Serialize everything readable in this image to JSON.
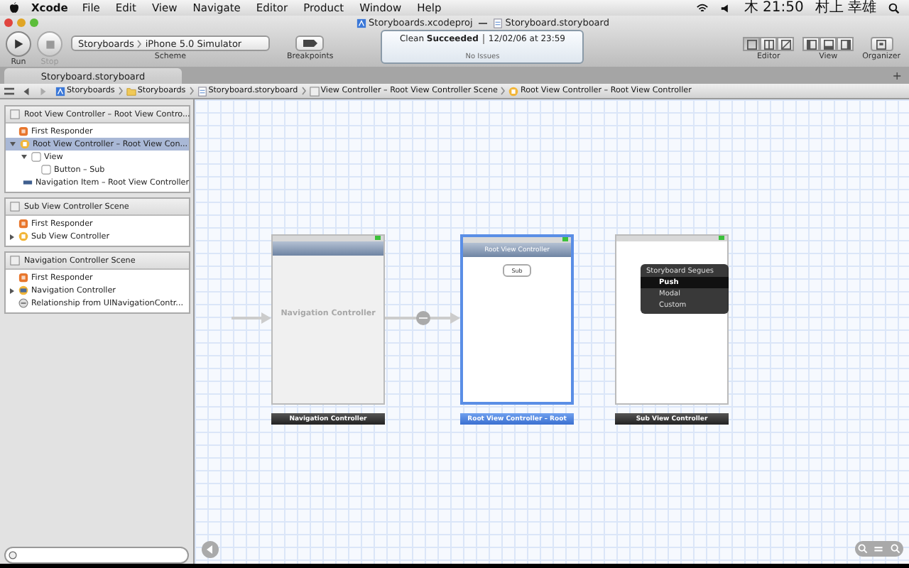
{
  "menu_bar": {
    "app": "Xcode",
    "items": [
      "File",
      "Edit",
      "View",
      "Navigate",
      "Editor",
      "Product",
      "Window",
      "Help"
    ],
    "clock": "木 21:50",
    "user": "村上 幸雄"
  },
  "window": {
    "project": "Storyboards.xcodeproj",
    "file": "Storyboard.storyboard"
  },
  "toolbar": {
    "run": {
      "label": "Run",
      "disabled": false
    },
    "stop": {
      "label": "Stop",
      "disabled": true
    },
    "scheme": {
      "project": "Storyboards",
      "destination": "iPhone 5.0 Simulator",
      "label": "Scheme"
    },
    "breakpoints": {
      "label": "Breakpoints"
    },
    "activity": {
      "status": "Clean **Succeeded**",
      "time": "12/02/06 at 23:59",
      "issues": "No Issues"
    },
    "editor": {
      "label": "Editor",
      "modes": [
        {
          "kind": "standard",
          "selected": true
        },
        {
          "kind": "assistant",
          "selected": false
        },
        {
          "kind": "version",
          "selected": false
        }
      ]
    },
    "view": {
      "label": "View",
      "panes": [
        {
          "kind": "left",
          "selected": false
        },
        {
          "kind": "bottom",
          "selected": false
        },
        {
          "kind": "right",
          "selected": false
        }
      ]
    },
    "organizer": {
      "label": "Organizer"
    }
  },
  "tabs": [
    {
      "label": "Storyboard.storyboard",
      "selected": true
    }
  ],
  "add_tab": "+",
  "jump_bar": [
    {
      "kind": "project",
      "label": "Storyboards"
    },
    {
      "kind": "folder",
      "label": "Storyboards"
    },
    {
      "kind": "file",
      "label": "Storyboard.storyboard"
    },
    {
      "kind": "scene",
      "label": "View Controller – Root View Controller Scene"
    },
    {
      "kind": "controller",
      "label": "Root View Controller – Root View Controller"
    }
  ],
  "outline": [
    {
      "title": "Root View Controller – Root View Contro...",
      "items": [
        {
          "kind": "responder",
          "label": "First Responder",
          "selected": false
        },
        {
          "kind": "controller",
          "label": "Root View Controller – Root View Con...",
          "selected": true,
          "expanded": true,
          "children": [
            {
              "kind": "view",
              "label": "View",
              "selected": false,
              "expanded": true,
              "children": [
                {
                  "kind": "view",
                  "label": "Button – Sub",
                  "selected": false
                }
              ]
            },
            {
              "kind": "navitem",
              "label": "Navigation Item – Root View Controller",
              "selected": false
            }
          ]
        }
      ]
    },
    {
      "title": "Sub View Controller Scene",
      "items": [
        {
          "kind": "responder",
          "label": "First Responder",
          "selected": false
        },
        {
          "kind": "controller",
          "label": "Sub View Controller",
          "selected": false,
          "expanded": false
        }
      ]
    },
    {
      "title": "Navigation Controller Scene",
      "items": [
        {
          "kind": "responder",
          "label": "First Responder",
          "selected": false
        },
        {
          "kind": "navcontroller",
          "label": "Navigation Controller",
          "selected": false,
          "expanded": false
        },
        {
          "kind": "relationship",
          "label": "Relationship from UINavigationContr...",
          "selected": false
        }
      ]
    }
  ],
  "canvas": {
    "scenes": [
      {
        "kind": "navigation",
        "watermark": "Navigation Controller",
        "caption": "Navigation Controller",
        "selected": false
      },
      {
        "kind": "view",
        "bar_title": "Root View Controller",
        "button": "Sub",
        "caption": "Root View Controller – Root",
        "selected": true
      },
      {
        "kind": "view",
        "caption": "Sub View Controller",
        "selected": false
      }
    ],
    "segue_menu": {
      "title": "Storyboard Segues",
      "options": [
        {
          "label": "Push",
          "selected": true
        },
        {
          "label": "Modal",
          "selected": false
        },
        {
          "label": "Custom",
          "selected": false
        }
      ]
    }
  }
}
